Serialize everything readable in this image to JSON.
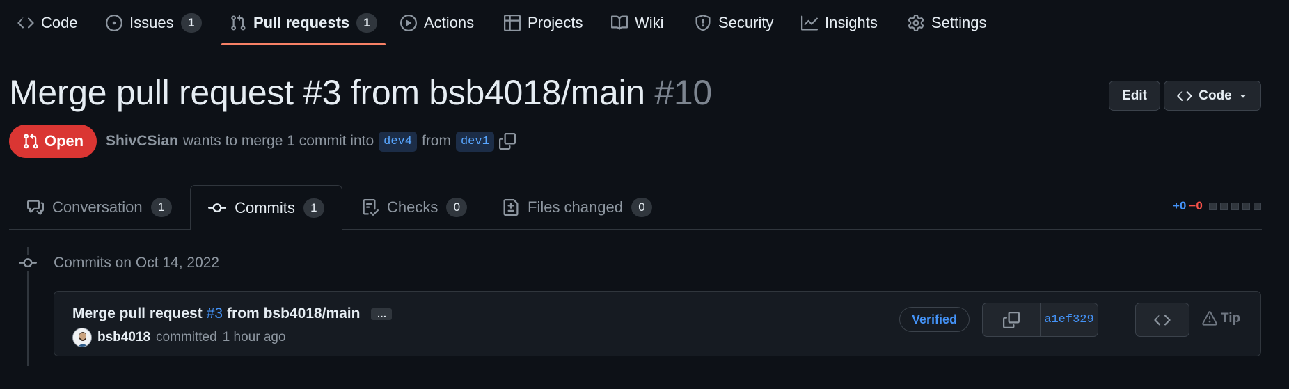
{
  "nav": {
    "items": [
      {
        "label": "Code",
        "icon": "code-icon"
      },
      {
        "label": "Issues",
        "icon": "issue-opened-icon",
        "count": "1"
      },
      {
        "label": "Pull requests",
        "icon": "git-pull-request-icon",
        "count": "1",
        "active": true
      },
      {
        "label": "Actions",
        "icon": "play-icon"
      },
      {
        "label": "Projects",
        "icon": "table-icon"
      },
      {
        "label": "Wiki",
        "icon": "book-icon"
      },
      {
        "label": "Security",
        "icon": "shield-icon"
      },
      {
        "label": "Insights",
        "icon": "graph-icon"
      },
      {
        "label": "Settings",
        "icon": "gear-icon"
      }
    ]
  },
  "pr": {
    "title": "Merge pull request #3 from bsb4018/main",
    "number": "#10",
    "state": "Open",
    "author": "ShivCSian",
    "merge_text": "wants to merge 1 commit into",
    "base_branch": "dev4",
    "from_text": "from",
    "head_branch": "dev1"
  },
  "actions": {
    "edit_label": "Edit",
    "code_label": "Code"
  },
  "tabs": [
    {
      "label": "Conversation",
      "count": "1",
      "icon": "comment-discussion-icon"
    },
    {
      "label": "Commits",
      "count": "1",
      "icon": "git-commit-icon",
      "active": true
    },
    {
      "label": "Checks",
      "count": "0",
      "icon": "checklist-icon"
    },
    {
      "label": "Files changed",
      "count": "0",
      "icon": "file-diff-icon"
    }
  ],
  "diffstat": {
    "added": "+0",
    "removed": "−0"
  },
  "timeline": {
    "date_heading": "Commits on Oct 14, 2022"
  },
  "commit": {
    "title_prefix": "Merge pull request",
    "pr_link": "#3",
    "title_suffix": "from bsb4018/main",
    "ellipsis": "…",
    "user": "bsb4018",
    "action": "committed",
    "time": "1 hour ago",
    "verified": "Verified",
    "sha": "a1ef329",
    "tip": "Tip"
  },
  "colors": {
    "background": "#0d1117",
    "accent_underline": "#f78166",
    "open_badge": "#da3633",
    "link": "#4493f8"
  }
}
